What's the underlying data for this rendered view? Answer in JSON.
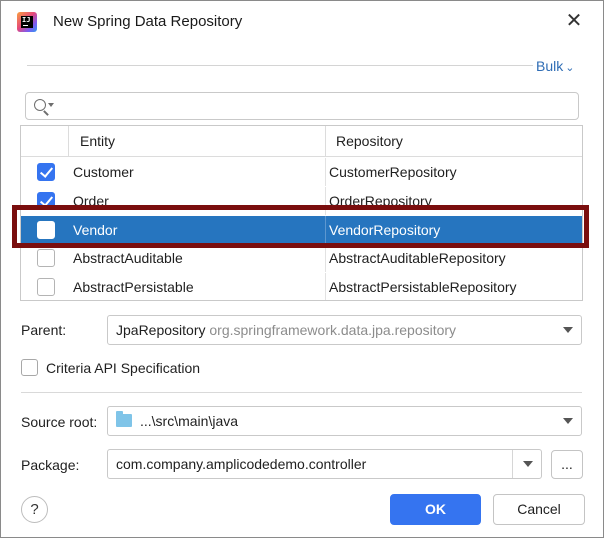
{
  "window": {
    "title": "New Spring Data Repository",
    "close_glyph": "✕"
  },
  "bulk": {
    "label": "Bulk",
    "chevron": "⌄"
  },
  "search": {
    "value": "",
    "placeholder": ""
  },
  "table": {
    "headers": {
      "entity": "Entity",
      "repository": "Repository"
    },
    "rows": [
      {
        "entity": "Customer",
        "repository": "CustomerRepository",
        "checked": true,
        "selected": false
      },
      {
        "entity": "Order",
        "repository": "OrderRepository",
        "checked": true,
        "selected": false
      },
      {
        "entity": "Vendor",
        "repository": "VendorRepository",
        "checked": false,
        "selected": true
      },
      {
        "entity": "AbstractAuditable",
        "repository": "AbstractAuditableRepository",
        "checked": false,
        "selected": false
      },
      {
        "entity": "AbstractPersistable",
        "repository": "AbstractPersistableRepository",
        "checked": false,
        "selected": false
      }
    ]
  },
  "parent": {
    "label": "Parent:",
    "value": "JpaRepository",
    "hint": "org.springframework.data.jpa.repository"
  },
  "criteria": {
    "label": "Criteria API Specification",
    "checked": false
  },
  "source_root": {
    "label": "Source root:",
    "value": "...\\src\\main\\java"
  },
  "package": {
    "label": "Package:",
    "value": "com.company.amplicodedemo.controller",
    "browse_label": "..."
  },
  "footer": {
    "help_label": "?",
    "ok_label": "OK",
    "cancel_label": "Cancel"
  },
  "colors": {
    "accent": "#3574f0",
    "selection": "#2675bf",
    "highlight_border": "#7a0e0e",
    "link": "#2f6db5"
  }
}
